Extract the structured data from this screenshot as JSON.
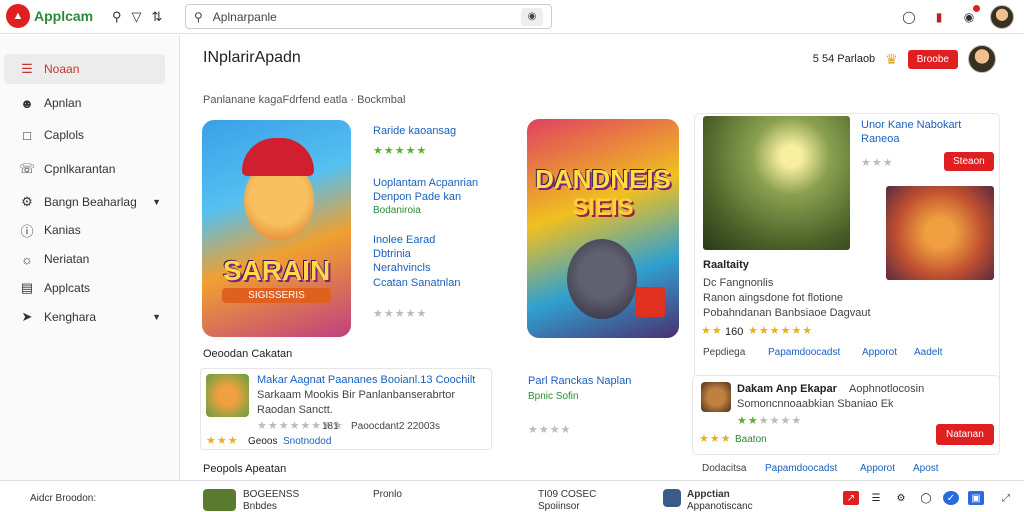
{
  "topbar": {
    "logo_text": "Applcam",
    "search_placeholder": "Aplnarpanle"
  },
  "sidebar": {
    "items": [
      {
        "label": "Noaan",
        "icon": "list-icon"
      },
      {
        "label": "Apnlan",
        "icon": "user-icon"
      },
      {
        "label": "Caplols",
        "icon": "box-icon"
      },
      {
        "label": "Cpnlkarantan",
        "icon": "phone-icon"
      },
      {
        "label": "Bangn Beaharlag",
        "icon": "gear-icon"
      },
      {
        "label": "Kanias",
        "icon": "info-icon"
      },
      {
        "label": "Neriatan",
        "icon": "globe-icon"
      },
      {
        "label": "Applcats",
        "icon": "doc-icon"
      },
      {
        "label": "Kenghara",
        "icon": "tag-icon"
      }
    ]
  },
  "main": {
    "title": "INplarirApadn",
    "header_link": "5 54 Parlaob",
    "header_button": "Broobe",
    "subtitle": "Panlanane kagaFdrfend eatla · Bockmbal",
    "game1": {
      "art_title": "SARAIN",
      "art_sub": "SIGISSERIS",
      "name": "Raride kaoansag",
      "desc": [
        "Uoplantam Acpanrian",
        "Denpon Pade kan"
      ],
      "tag": "Bodaniroia",
      "meta": [
        "Inolee Earad",
        "Dbtrinia",
        "Nerahvincls",
        "Ccatan Sanatnlan"
      ]
    },
    "game2": {
      "art_title": "DANDNEIS",
      "art_sub": "SIEIS",
      "name": "Parl Ranckas Naplan",
      "tag": "Bpnic Sofin"
    },
    "section_more": "Oeoodan Cakatan",
    "row1": {
      "title": "Makar Aagnat Paananes Booianl.13 Coochilt",
      "line2": "Sarkaam Mookis Bir Panlanbanserabrtor",
      "line3": "Raodan Sanctt.",
      "rating": "181",
      "extra": "Paoocdant2 22003s",
      "tag1": "Geoos",
      "tag2": "Snotnodod"
    },
    "section_bottom": "Peopols Apeatan",
    "right": {
      "title": "Unor Kane Nabokart",
      "sub": "Raneoa",
      "button": "Steaon",
      "name": "Raaltaity",
      "line1": "Dc Fangnonlis",
      "line2": "Ranon aingsdone fot flotione",
      "line3": "Pobahndanan Banbsiaoe Dagvaut",
      "rating": "160",
      "footer": [
        "Pepdiega",
        "Papamdoocadst",
        "Apporot",
        "Aadelt"
      ]
    },
    "card2": {
      "title": "Dakam Anp Ekapar",
      "title2": "Aophnotlocosin",
      "line": "Somoncnnoaabkian Sbaniao Ek",
      "tag": "Baaton",
      "button": "Natanan",
      "footer": [
        "Dodacitsa",
        "Papamdoocadst",
        "Apporot",
        "Apost"
      ]
    }
  },
  "footer": {
    "left": "Aidcr Broodon:",
    "center1": "BOGEENSS",
    "center1b": "Bnbdes",
    "center2": "Pronlo",
    "center3": "TI09 COSEC",
    "center3b": "Spoiinsor",
    "app": "Appctian",
    "app_sub": "Appanotiscanc"
  }
}
